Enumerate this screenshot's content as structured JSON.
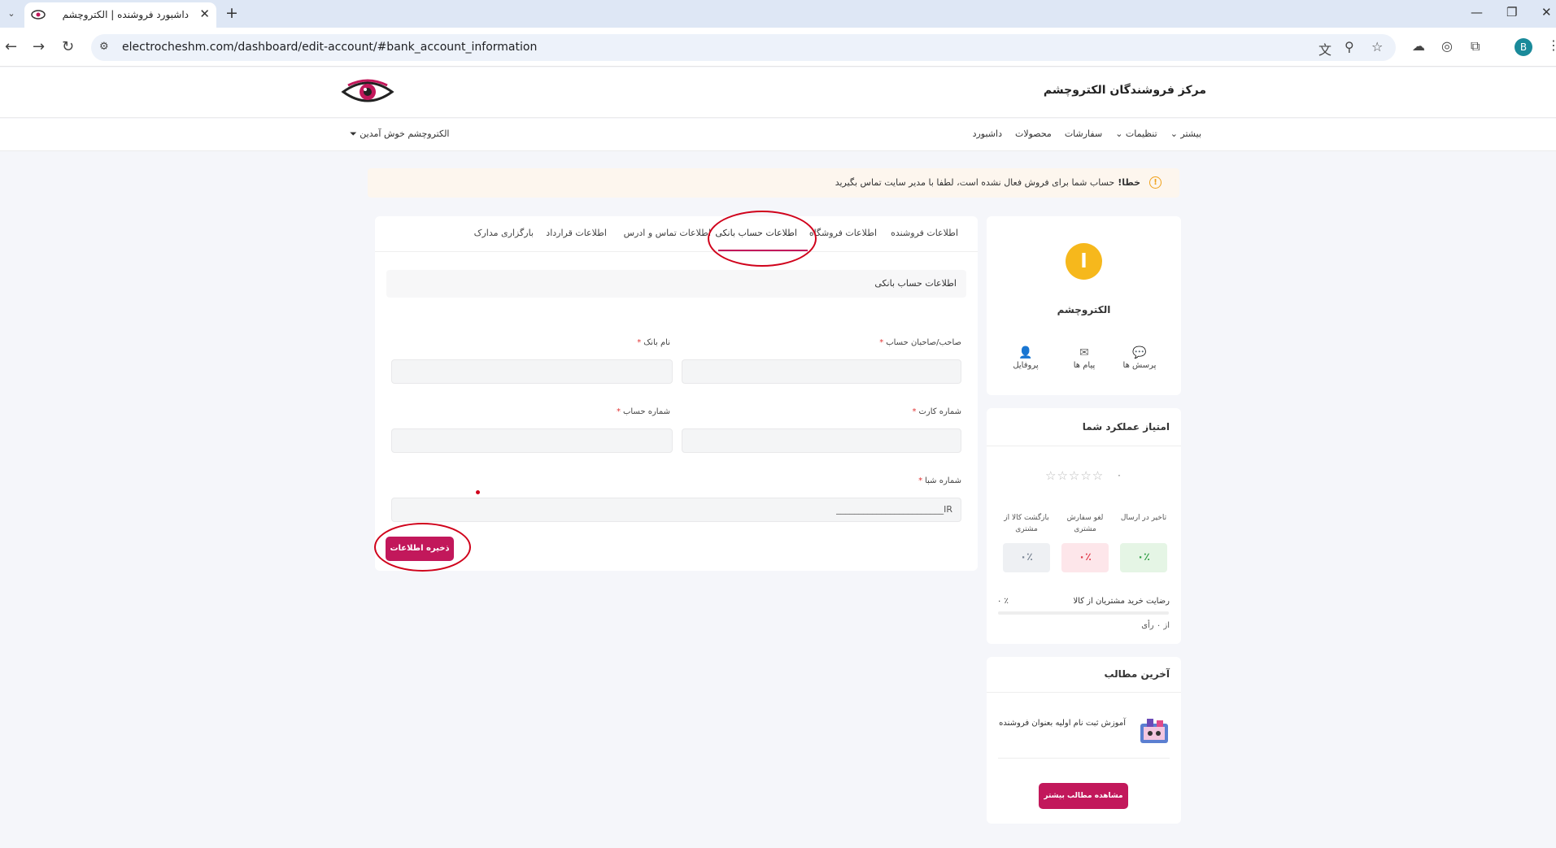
{
  "browser": {
    "tab_list_icon": "chevron-down-icon",
    "tab_title": "داشبورد فروشنده | الکتروچشم",
    "tab_close": "✕",
    "new_tab": "+",
    "window_minimize": "—",
    "window_restore": "❐",
    "window_close": "✕",
    "back": "←",
    "forward": "→",
    "reload": "↻",
    "url": "electrocheshm.com/dashboard/edit-account/#bank_account_information",
    "profile_initial": "B"
  },
  "header": {
    "site_title": "مرکز فروشندگان الکتروچشم",
    "nav": [
      "داشبورد",
      "محصولات",
      "سفارشات",
      "تنظیمات ⌄",
      "بیشتر ⌄"
    ],
    "welcome": "الکتروچشم خوش آمدین ⏷"
  },
  "alert": {
    "label": "خطا!",
    "message": "حساب شما برای فروش فعال نشده است، لطفا با مدیر سایت تماس بگیرید",
    "icon": "!"
  },
  "tabs": {
    "seller_info": "اطلاعات فروشنده",
    "store_info": "اطلاعات فروشگاه",
    "bank_info": "اطلاعات حساب بانکی",
    "contact_info": "اطلاعات تماس و ادرس",
    "contract_info": "اطلاعات قرارداد",
    "documents": "بارگزاری مدارک"
  },
  "form": {
    "section_title": "اطلاعات حساب بانکی",
    "account_holder_label": "صاحب/صاحبان حساب",
    "bank_name_label": "نام بانک",
    "card_number_label": "شماره کارت",
    "account_number_label": "شماره حساب",
    "sheba_label": "شماره شبا",
    "required_mark": "*",
    "sheba_value": "IR________________________",
    "save_label": "ذخیره اطلاعات"
  },
  "profile": {
    "avatar_letter": "ا",
    "store_name": "الکتروچشم",
    "quick_links": {
      "questions": "پرسش ها",
      "messages": "پیام ها",
      "profile": "پروفایل"
    },
    "icons": {
      "questions": "💬",
      "messages": "✉",
      "profile": "👤"
    }
  },
  "performance": {
    "title": "امتیاز عملکرد شما",
    "rating": "۰",
    "stars": "☆☆☆☆☆",
    "metrics": {
      "delay_label": "تاخیر در ارسال",
      "delay_value": "۰٪",
      "cancel_label": "لغو سفارش مشتری",
      "cancel_value": "۰٪",
      "return_label": "بازگشت کالا از مشتری",
      "return_value": "۰٪"
    },
    "satisfaction_label": "رضایت خرید مشتریان از کالا",
    "satisfaction_value": "۰ ٪",
    "votes": "از ۰ رأی"
  },
  "posts": {
    "title": "آخرین مطالب",
    "items": [
      "آموزش ثبت نام اولیه بعنوان فروشنده"
    ],
    "more_label": "مشاهده مطالب بیشتر"
  },
  "colors": {
    "brand": "#c2185b",
    "warning": "#f0a11a",
    "annotation": "#d0021b"
  }
}
